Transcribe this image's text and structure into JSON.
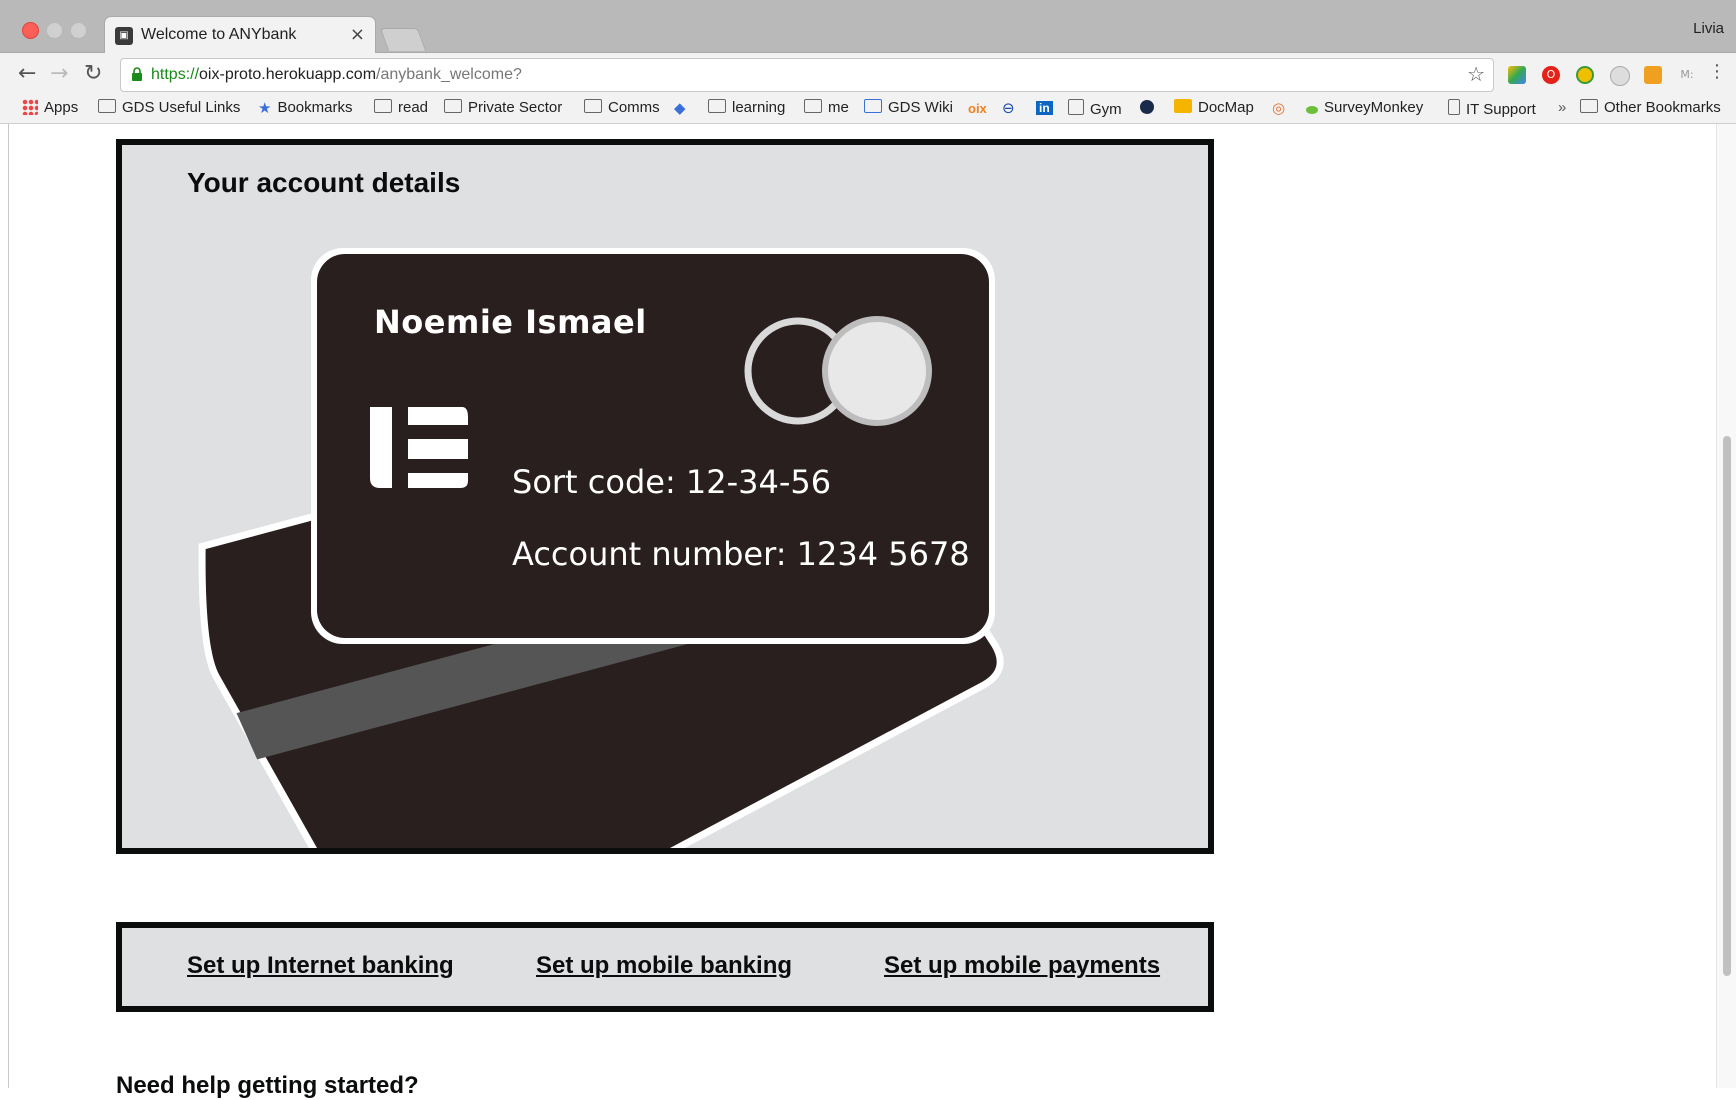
{
  "browser": {
    "tab_title": "Welcome to ANYbank",
    "tab_close": "×",
    "profile_name": "Livia",
    "url_scheme": "https://",
    "url_host": "oix-proto.herokuapp.com",
    "url_path": "/anybank_welcome?",
    "bookmarks": [
      {
        "label": "Apps",
        "icon": "apps-grid-icon"
      },
      {
        "label": "GDS Useful Links",
        "icon": "folder-icon"
      },
      {
        "label": "Bookmarks",
        "icon": "star-icon"
      },
      {
        "label": "read",
        "icon": "folder-icon"
      },
      {
        "label": "Private Sector",
        "icon": "folder-icon"
      },
      {
        "label": "Comms",
        "icon": "folder-icon"
      },
      {
        "label": "learning",
        "icon": "folder-icon"
      },
      {
        "label": "me",
        "icon": "folder-icon"
      },
      {
        "label": "GDS Wiki",
        "icon": "wiki-icon"
      },
      {
        "label": "Gym",
        "icon": "gym-icon"
      },
      {
        "label": "DocMap",
        "icon": "docmap-icon"
      },
      {
        "label": "SurveyMonkey",
        "icon": "surveymonkey-icon"
      },
      {
        "label": "IT Support",
        "icon": "page-icon"
      },
      {
        "label": "»",
        "icon": "overflow-chevron-icon"
      },
      {
        "label": "Other Bookmarks",
        "icon": "folder-icon"
      }
    ],
    "bookmark_icon_oix": "oix",
    "bookmark_icon_linkedin": "in",
    "extension_label_m": "M:"
  },
  "page": {
    "panel_heading": "Your account details",
    "card": {
      "holder_name": "Noemie Ismael",
      "sort_code": "Sort code: 12-34-56",
      "account_number": "Account number: 1234 5678"
    },
    "links": [
      {
        "label": "Set up Internet banking"
      },
      {
        "label": "Set up mobile banking"
      },
      {
        "label": "Set up mobile payments"
      }
    ],
    "help_heading": "Need help getting started?"
  },
  "colors": {
    "panel_bg": "#dee0e2",
    "border": "#0b0c0c",
    "card_bg": "#2a1f1f",
    "url_scheme": "#1a8a1a"
  }
}
